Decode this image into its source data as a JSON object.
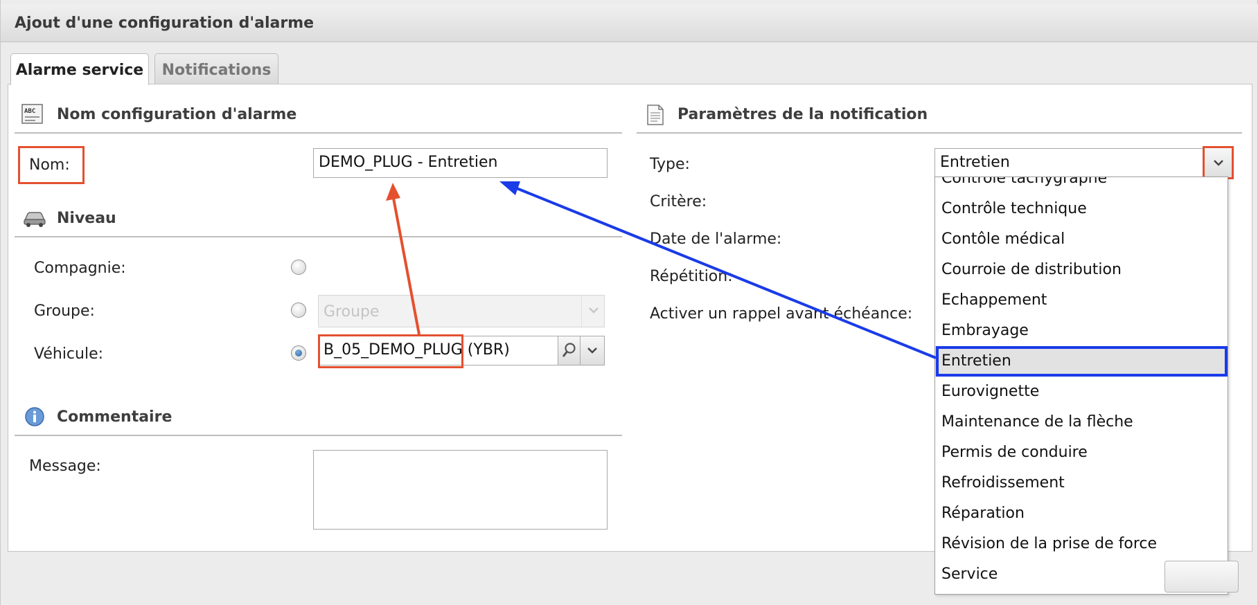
{
  "window": {
    "title": "Ajout d'une configuration d'alarme"
  },
  "tabs": [
    {
      "label": "Alarme service",
      "active": true
    },
    {
      "label": "Notifications",
      "active": false
    }
  ],
  "left": {
    "name_section": {
      "heading": "Nom configuration d'alarme",
      "icon": "abc-text-icon",
      "nom_label": "Nom:",
      "nom_value": "DEMO_PLUG - Entretien"
    },
    "niveau_section": {
      "heading": "Niveau",
      "icon": "car-icon",
      "compagnie_label": "Compagnie:",
      "groupe_label": "Groupe:",
      "groupe_placeholder": "Groupe",
      "vehicule_label": "Véhicule:",
      "vehicule_value": "B_05_DEMO_PLUG (YBR)",
      "selected_level": "Véhicule"
    },
    "commentaire_section": {
      "heading": "Commentaire",
      "icon": "info-icon",
      "message_label": "Message:",
      "message_value": ""
    }
  },
  "right": {
    "heading": "Paramètres de la notification",
    "icon": "document-icon",
    "type_label": "Type:",
    "type_value": "Entretien",
    "critere_label": "Critère:",
    "date_label": "Date de l'alarme:",
    "repetition_label": "Répétition:",
    "rappel_label": "Activer un rappel avant échéance:",
    "type_options": [
      "Contrôle tachygraphe",
      "Contrôle technique",
      "Contôle médical",
      "Courroie de distribution",
      "Echappement",
      "Embrayage",
      "Entretien",
      "Eurovignette",
      "Maintenance de la flèche",
      "Permis de conduire",
      "Refroidissement",
      "Réparation",
      "Révision de la prise de force",
      "Service"
    ],
    "selected_option": "Entretien"
  },
  "annotations": {
    "red_color": "#e4502f",
    "blue_color": "#1a3be8"
  }
}
